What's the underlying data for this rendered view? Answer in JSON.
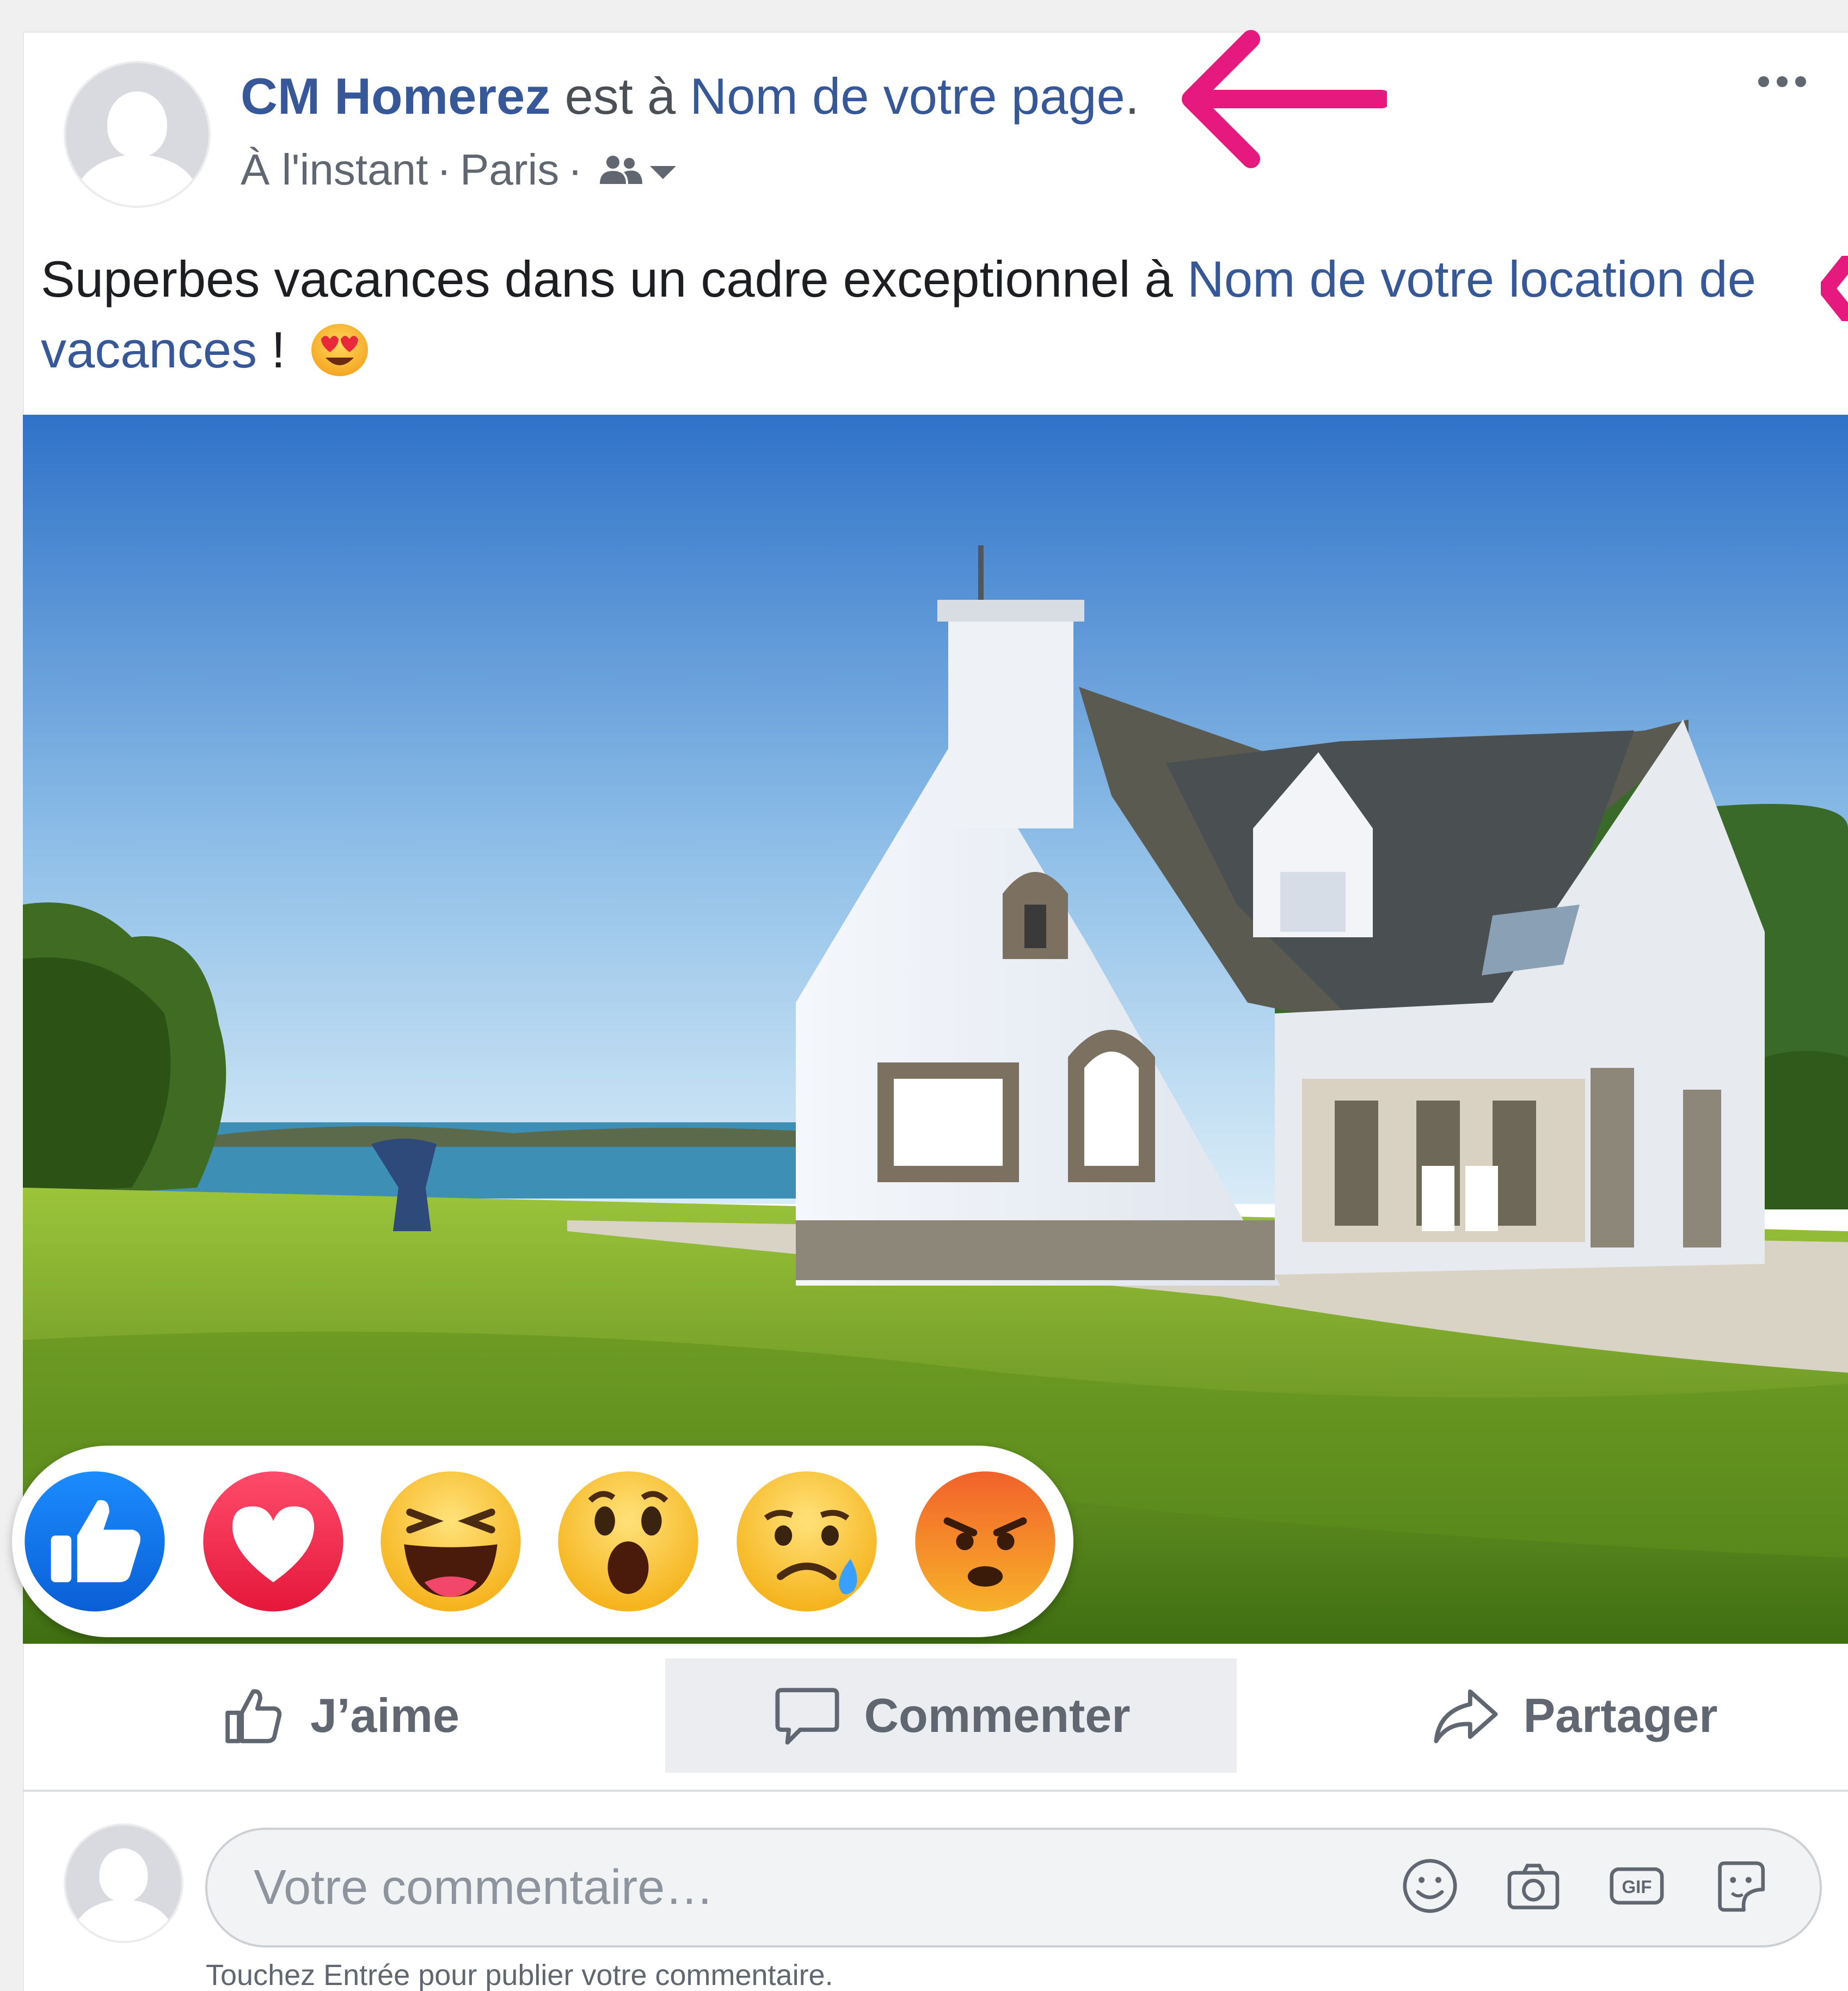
{
  "post": {
    "author": "CM Homerez",
    "action_text": " est à ",
    "page_link": "Nom de votre page",
    "period": ".",
    "time": "À l'instant",
    "separator": "·",
    "location": "Paris",
    "audience_icon": "friends-icon",
    "text_before_link": "Superbes vacances dans un cadre exceptionnel à ",
    "text_link": "Nom de votre location de vacances",
    "text_after_link": " !",
    "emoji": "heart-eyes-emoji"
  },
  "reactions": [
    "like-reaction",
    "love-reaction",
    "haha-reaction",
    "wow-reaction",
    "sad-reaction",
    "angry-reaction"
  ],
  "actions": {
    "like": "J’aime",
    "comment": "Commenter",
    "share": "Partager"
  },
  "comment": {
    "placeholder": "Votre commentaire…",
    "hint": "Touchez Entrée pour publier votre commentaire.",
    "icons": [
      "smiley-icon",
      "camera-icon",
      "gif-icon",
      "sticker-icon"
    ]
  },
  "annotations": {
    "arrow_color": "#e6197e"
  },
  "colors": {
    "link": "#365899",
    "muted": "#606770",
    "hover_bg": "#ebedf0"
  }
}
